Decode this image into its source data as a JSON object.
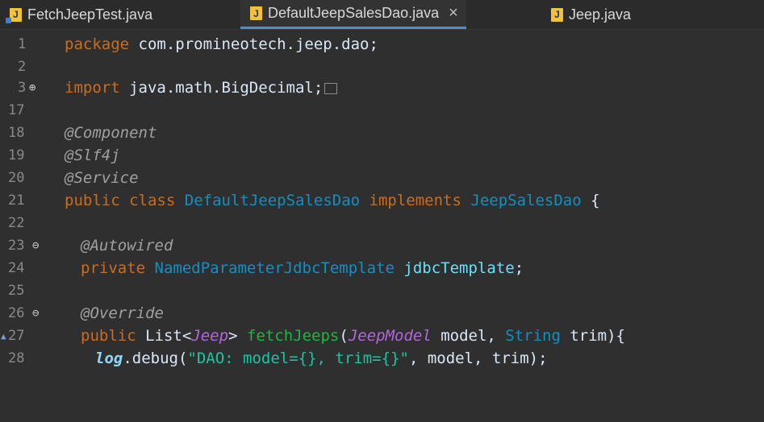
{
  "tabs": [
    {
      "label": "FetchJeepTest.java",
      "active": false
    },
    {
      "label": "DefaultJeepSalesDao.java",
      "active": true,
      "close": "×"
    },
    {
      "label": "Jeep.java",
      "active": false
    }
  ],
  "code": {
    "l1": {
      "no": "1",
      "kw": "package",
      "rest": " com.promineotech.jeep.dao;"
    },
    "l2": {
      "no": "2"
    },
    "l3": {
      "no": "3",
      "marker": "⊕",
      "kw": "import",
      "rest": " java.math.BigDecimal;"
    },
    "l17": {
      "no": "17"
    },
    "l18": {
      "no": "18",
      "ann": "@Component"
    },
    "l19": {
      "no": "19",
      "ann": "@Slf4j"
    },
    "l20": {
      "no": "20",
      "ann": "@Service"
    },
    "l21": {
      "no": "21",
      "kw1": "public",
      "kw2": "class",
      "cls": "DefaultJeepSalesDao",
      "kw3": "implements",
      "iface": "JeepSalesDao",
      "brace": " {"
    },
    "l22": {
      "no": "22"
    },
    "l23": {
      "no": "23",
      "marker": "⊖",
      "ann": "@Autowired"
    },
    "l24": {
      "no": "24",
      "kw": "private",
      "type": "NamedParameterJdbcTemplate",
      "fld": "jdbcTemplate",
      "end": ";"
    },
    "l25": {
      "no": "25"
    },
    "l26": {
      "no": "26",
      "marker": "⊖",
      "ann": "@Override"
    },
    "l27": {
      "no": "27",
      "kw": "public",
      "t1": "List<",
      "t2": "Jeep",
      "t3": ">",
      "meth": "fetchJeeps",
      "p1": "(",
      "ptype": "JeepModel",
      "p2": " model, ",
      "ptype2": "String",
      "p3": " trim){"
    },
    "l28": {
      "no": "28",
      "log": "log",
      "call": ".debug(",
      "str": "\"DAO: model={}, trim={}\"",
      "args": ", model, trim);"
    }
  },
  "colors": {
    "background": "#2f2f2f",
    "keyword": "#cc6c1d",
    "annotation": "#a0a0a0",
    "type": "#1290c3",
    "string": "#17c6a3",
    "active_tab_underline": "#4e8fd0"
  },
  "icons": {
    "java_file": "java-file-icon",
    "test_file": "java-test-file-icon",
    "close": "close-icon",
    "fold_expand": "fold-expand-icon",
    "fold_collapse": "fold-collapse-icon",
    "override_marker": "override-arrow-icon"
  }
}
